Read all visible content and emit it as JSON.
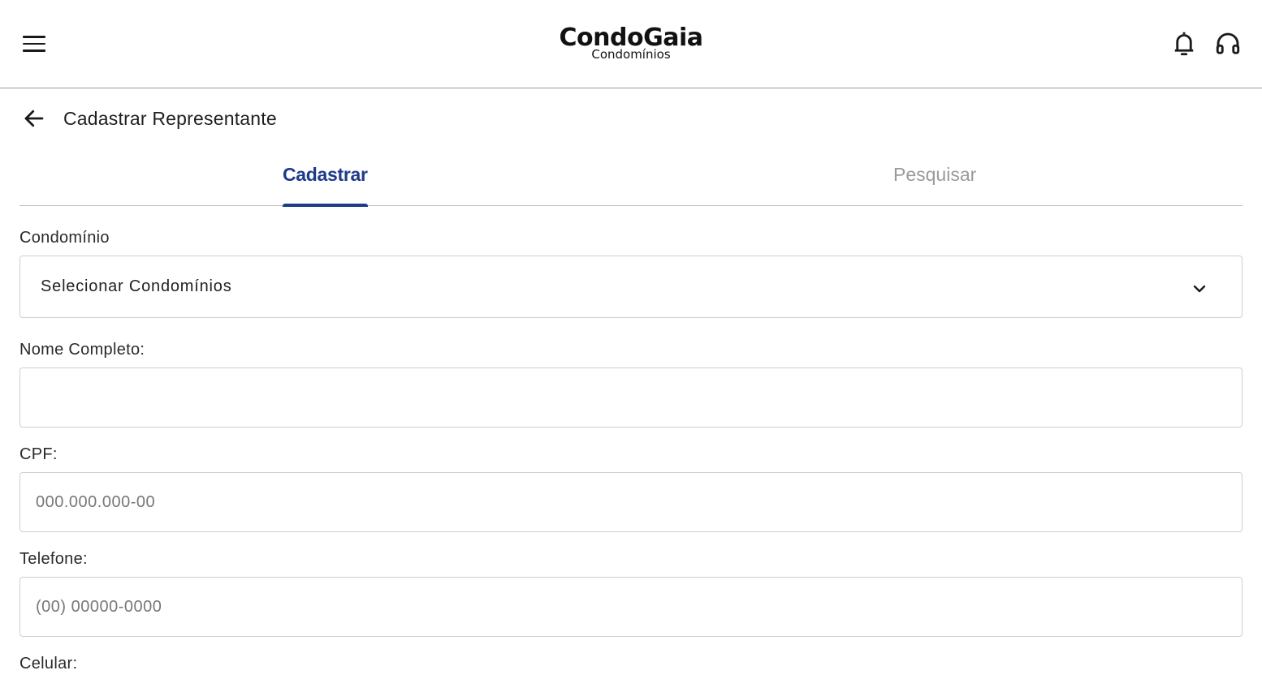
{
  "header": {
    "logo_main": "CondoGaia",
    "logo_sub": "Condomínios",
    "icons": [
      "menu-icon",
      "bell-icon",
      "headset-icon"
    ]
  },
  "page": {
    "title": "Cadastrar Representante"
  },
  "tabs": [
    {
      "label": "Cadastrar",
      "active": true
    },
    {
      "label": "Pesquisar",
      "active": false
    }
  ],
  "form": {
    "condominio": {
      "label": "Condomínio",
      "selected": "Selecionar Condomínios"
    },
    "nome": {
      "label": "Nome Completo:",
      "value": ""
    },
    "cpf": {
      "label": "CPF:",
      "placeholder": "000.000.000-00"
    },
    "telefone": {
      "label": "Telefone:",
      "placeholder": "(00) 00000-0000"
    },
    "celular": {
      "label": "Celular:"
    }
  },
  "colors": {
    "accent": "#1e3a8a",
    "inactive_tab": "#9a9a9a",
    "border": "#cfcfcf"
  }
}
